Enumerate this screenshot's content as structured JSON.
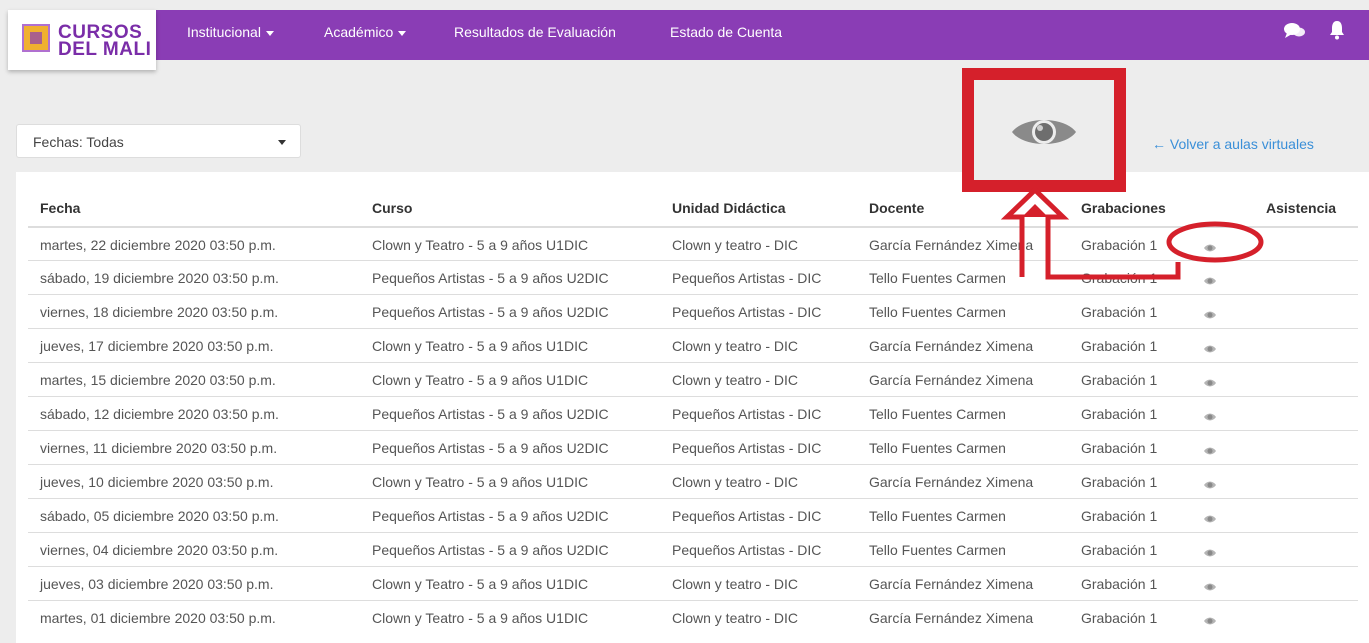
{
  "brand": {
    "line1": "CURSOS",
    "line2": "DEL MALI"
  },
  "nav": {
    "items": [
      "Institucional",
      "Académico",
      "Resultados de Evaluación",
      "Estado de Cuenta"
    ],
    "icons": [
      "chat-icon",
      "bell-icon"
    ]
  },
  "filter": {
    "value": "Fechas: Todas"
  },
  "back_link": "← Volver a aulas virtuales",
  "table": {
    "headers": [
      "Fecha",
      "Curso",
      "Unidad Didáctica",
      "Docente",
      "Grabaciones",
      "Asistencia"
    ],
    "rows": [
      [
        "martes, 22 diciembre 2020 03:50 p.m.",
        "Clown y Teatro - 5 a 9 años U1DIC",
        "Clown y teatro - DIC",
        "García Fernández Ximena",
        "Grabación 1"
      ],
      [
        "sábado, 19 diciembre 2020 03:50 p.m.",
        "Pequeños Artistas - 5 a 9 años U2DIC",
        "Pequeños Artistas - DIC",
        "Tello Fuentes Carmen",
        "Grabación 1"
      ],
      [
        "viernes, 18 diciembre 2020 03:50 p.m.",
        "Pequeños Artistas - 5 a 9 años U2DIC",
        "Pequeños Artistas - DIC",
        "Tello Fuentes Carmen",
        "Grabación 1"
      ],
      [
        "jueves, 17 diciembre 2020 03:50 p.m.",
        "Clown y Teatro - 5 a 9 años U1DIC",
        "Clown y teatro - DIC",
        "García Fernández Ximena",
        "Grabación 1"
      ],
      [
        "martes, 15 diciembre 2020 03:50 p.m.",
        "Clown y Teatro - 5 a 9 años U1DIC",
        "Clown y teatro - DIC",
        "García Fernández Ximena",
        "Grabación 1"
      ],
      [
        "sábado, 12 diciembre 2020 03:50 p.m.",
        "Pequeños Artistas - 5 a 9 años U2DIC",
        "Pequeños Artistas - DIC",
        "Tello Fuentes Carmen",
        "Grabación 1"
      ],
      [
        "viernes, 11 diciembre 2020 03:50 p.m.",
        "Pequeños Artistas - 5 a 9 años U2DIC",
        "Pequeños Artistas - DIC",
        "Tello Fuentes Carmen",
        "Grabación 1"
      ],
      [
        "jueves, 10 diciembre 2020 03:50 p.m.",
        "Clown y Teatro - 5 a 9 años U1DIC",
        "Clown y teatro - DIC",
        "García Fernández Ximena",
        "Grabación 1"
      ],
      [
        "sábado, 05 diciembre 2020 03:50 p.m.",
        "Pequeños Artistas - 5 a 9 años U2DIC",
        "Pequeños Artistas - DIC",
        "Tello Fuentes Carmen",
        "Grabación 1"
      ],
      [
        "viernes, 04 diciembre 2020 03:50 p.m.",
        "Pequeños Artistas - 5 a 9 años U2DIC",
        "Pequeños Artistas - DIC",
        "Tello Fuentes Carmen",
        "Grabación 1"
      ],
      [
        "jueves, 03 diciembre 2020 03:50 p.m.",
        "Clown y Teatro - 5 a 9 años U1DIC",
        "Clown y teatro - DIC",
        "García Fernández Ximena",
        "Grabación 1"
      ],
      [
        "martes, 01 diciembre 2020 03:50 p.m.",
        "Clown y Teatro - 5 a 9 años U1DIC",
        "Clown y teatro - DIC",
        "García Fernández Ximena",
        "Grabación 1"
      ]
    ],
    "row_icon": "eye-icon"
  },
  "annotation": {
    "color": "#d5202b",
    "icon": "eye-icon"
  },
  "colors": {
    "navbar": "#8a3db5",
    "link": "#3a8fd8",
    "annotation": "#d5202b"
  }
}
